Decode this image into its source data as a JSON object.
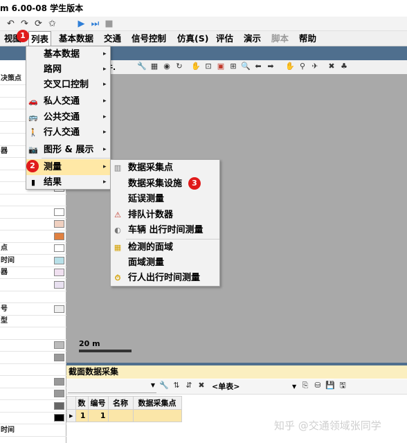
{
  "window": {
    "title": "m 6.00-08 学生版本"
  },
  "menubar": {
    "items": [
      {
        "label": "视图",
        "state": "normal"
      },
      {
        "label": "列表",
        "state": "active"
      },
      {
        "label": "基本数据",
        "state": "normal"
      },
      {
        "label": "交通",
        "state": "normal"
      },
      {
        "label": "信号控制",
        "state": "normal"
      },
      {
        "label": "仿真(S)",
        "state": "normal"
      },
      {
        "label": "评估",
        "state": "normal"
      },
      {
        "label": "演示",
        "state": "normal"
      },
      {
        "label": "脚本",
        "state": "disabled"
      },
      {
        "label": "帮助",
        "state": "normal"
      }
    ]
  },
  "badges": {
    "step1": "1",
    "step2": "2",
    "step3": "3"
  },
  "list_menu": {
    "items": [
      {
        "label": "基本数据",
        "icon": "",
        "submenu": true
      },
      {
        "label": "路网",
        "icon": "",
        "submenu": true
      },
      {
        "label": "交叉口控制",
        "icon": "",
        "submenu": true
      },
      {
        "label": "私人交通",
        "icon": "car-icon",
        "submenu": true
      },
      {
        "label": "公共交通",
        "icon": "bus-icon",
        "submenu": true
      },
      {
        "label": "行人交通",
        "icon": "pedestrian-icon",
        "submenu": true
      },
      {
        "label": "图形 & 展示",
        "icon": "camera-icon",
        "submenu": true
      },
      {
        "label": "测量",
        "icon": "",
        "submenu": true,
        "highlighted": true
      },
      {
        "label": "结果",
        "icon": "bar-chart-icon",
        "submenu": true
      }
    ]
  },
  "measure_submenu": {
    "items": [
      {
        "label": "数据采集点",
        "icon": "data-point-icon"
      },
      {
        "label": "数据采集设施",
        "icon": ""
      },
      {
        "label": "延误测量",
        "icon": ""
      },
      {
        "label": "排队计数器",
        "icon": "queue-warning-icon"
      },
      {
        "label": "车辆 出行时间测量",
        "icon": "vehicle-timer-icon"
      },
      {
        "label": "检测的面域",
        "icon": "area-grid-icon"
      },
      {
        "label": "面域测量",
        "icon": ""
      },
      {
        "label": "行人出行时间测量",
        "icon": "stopwatch-icon"
      }
    ]
  },
  "network": {
    "toolbar_fragment": "件.",
    "scale_label": "20 m"
  },
  "left_panel": {
    "rows": [
      "决策点",
      "",
      "",
      "",
      "",
      "",
      "器",
      "",
      "",
      "",
      "",
      "",
      "",
      "",
      "点",
      "时间",
      "器",
      "",
      "",
      "号",
      "型",
      "",
      "",
      "",
      "",
      "",
      "",
      "",
      "",
      "时间"
    ]
  },
  "lower_panel": {
    "title": "截面数据采集",
    "combo_value": "<单表>",
    "columns": [
      "数",
      "编号",
      "名称",
      "数据采集点"
    ],
    "rows": [
      {
        "count": "1",
        "id": "1",
        "name": "",
        "point": ""
      }
    ]
  },
  "watermark": "知乎 @交通领域张同学"
}
